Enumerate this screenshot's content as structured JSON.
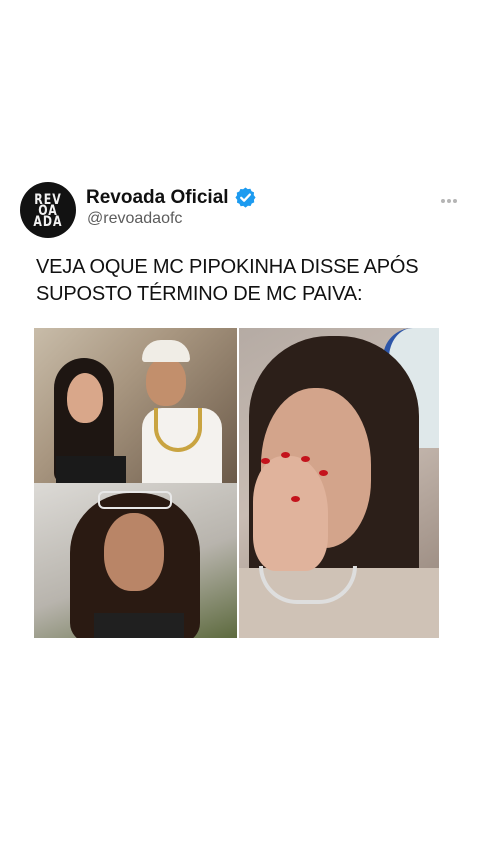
{
  "post": {
    "account_name": "Revoada Oficial",
    "handle": "@revoadaofc",
    "avatar_text": [
      "REV",
      "OA",
      "ADA"
    ],
    "verified": true,
    "text": "VEJA OQUE MC PIPOKINHA DISSE APÓS SUPOSTO TÉRMINO DE MC PAIVA:",
    "icons": {
      "verified": "verified-badge-icon",
      "more": "more-options-icon"
    },
    "colors": {
      "verified_badge": "#1d9bf0",
      "handle_gray": "#5c5c5c"
    }
  }
}
